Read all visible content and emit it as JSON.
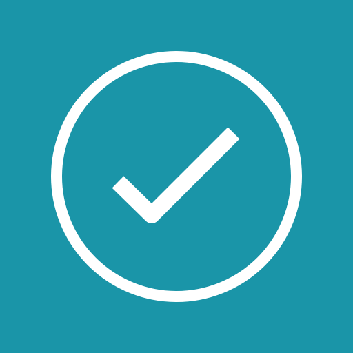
{
  "icon": {
    "name": "check-circle-icon",
    "background_color": "#1a95a8",
    "foreground_color": "#ffffff"
  }
}
